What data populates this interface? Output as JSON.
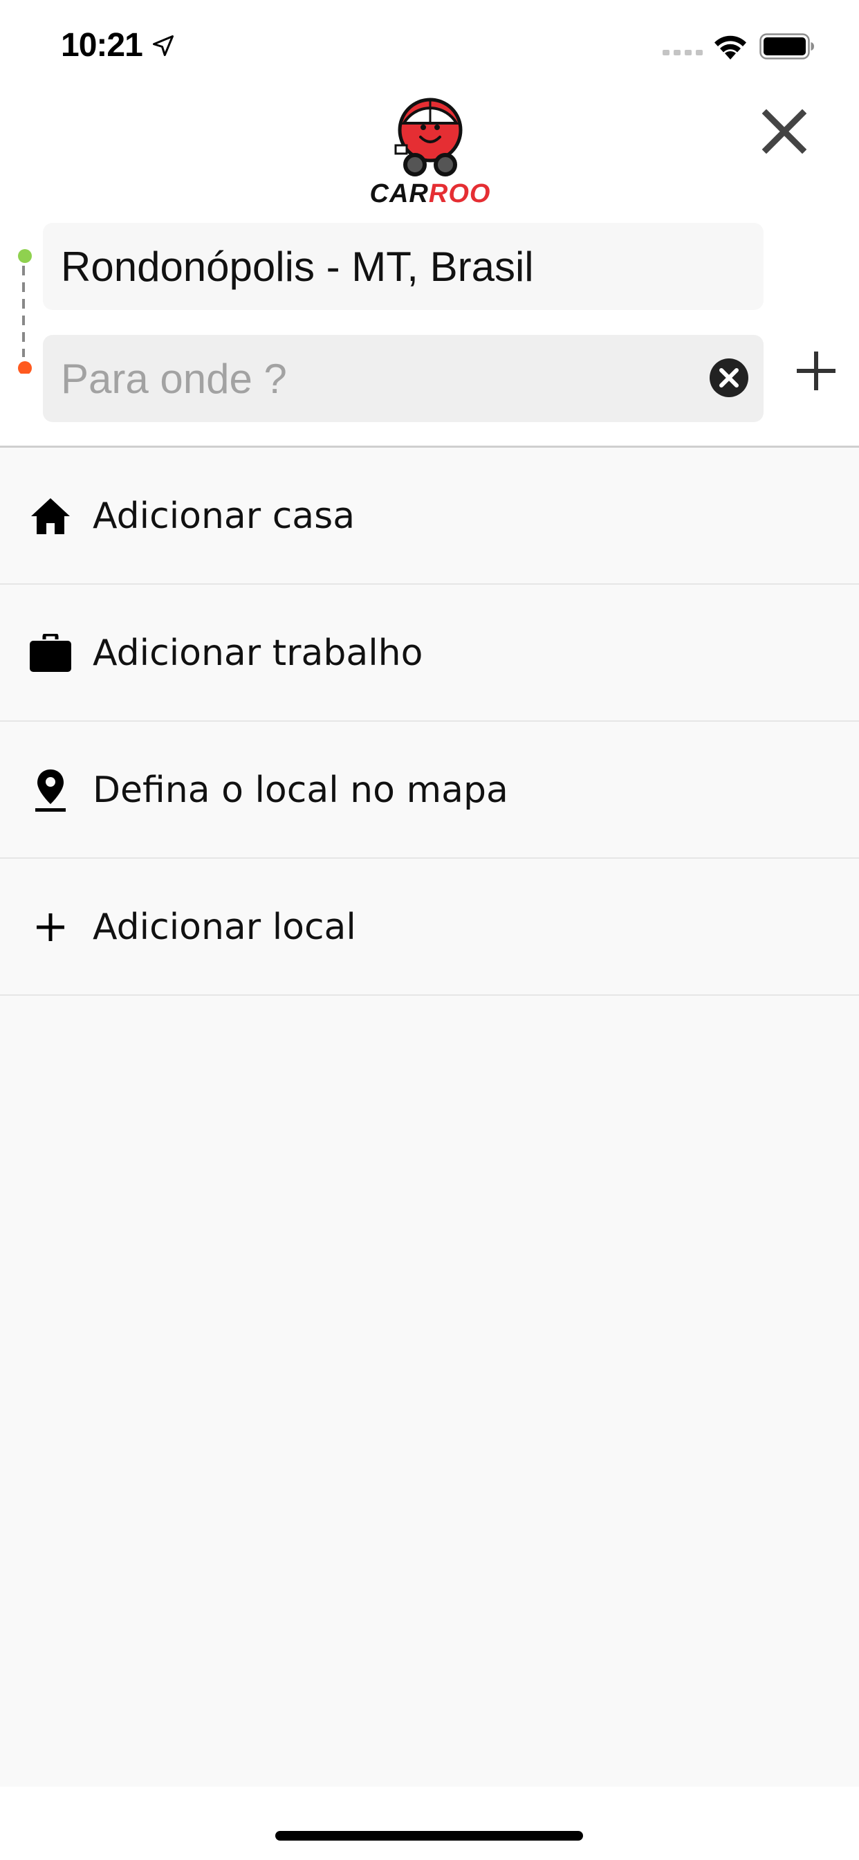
{
  "status_bar": {
    "time": "10:21"
  },
  "header": {
    "brand": "CARROO",
    "brand_part1": "CAR",
    "brand_part2": "ROO",
    "brand_color": "#e52e33"
  },
  "route": {
    "origin_value": "Rondonópolis - MT, Brasil",
    "destination_value": "",
    "destination_placeholder": "Para onde ?",
    "origin_dot_color": "#8fd14f",
    "destination_dot_color": "#ff5a1f"
  },
  "list": {
    "items": [
      {
        "label": "Adicionar casa",
        "icon": "home-icon"
      },
      {
        "label": "Adicionar trabalho",
        "icon": "briefcase-icon"
      },
      {
        "label": "Defina o local no mapa",
        "icon": "map-pin-icon"
      },
      {
        "label": "Adicionar local",
        "icon": "plus-icon"
      }
    ]
  }
}
